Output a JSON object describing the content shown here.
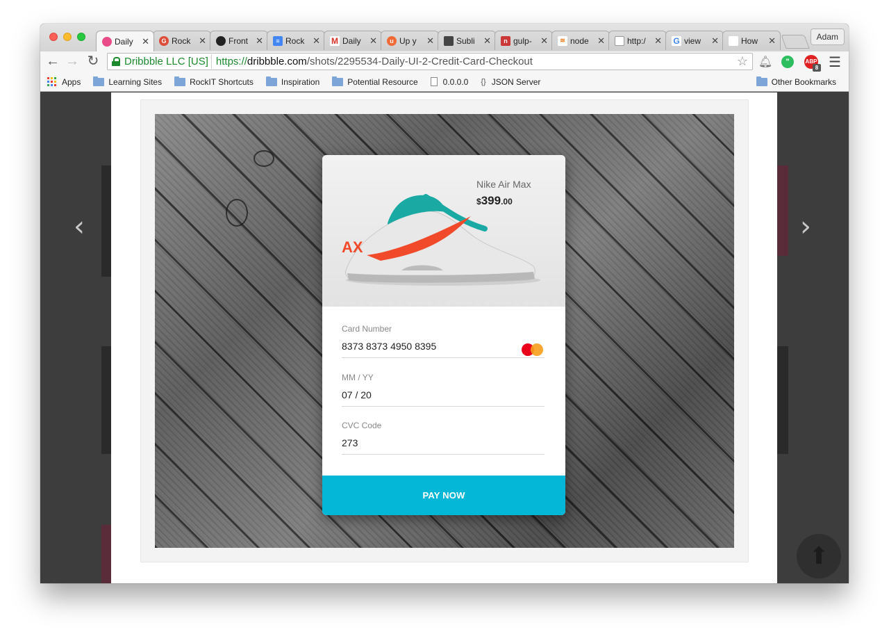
{
  "window": {
    "profile_label": "Adam"
  },
  "tabs": [
    {
      "title": "Daily",
      "icon": "dribbble-icon",
      "color": "#ea4c89"
    },
    {
      "title": "Rock",
      "icon": "google-plus-icon",
      "color": "#dd4b39"
    },
    {
      "title": "Front",
      "icon": "github-icon",
      "color": "#222222"
    },
    {
      "title": "Rock",
      "icon": "google-docs-icon",
      "color": "#4285f4"
    },
    {
      "title": "Daily",
      "icon": "gmail-icon",
      "color": "#d93025"
    },
    {
      "title": "Up y",
      "icon": "upwork-icon",
      "color": "#f06a35"
    },
    {
      "title": "Subli",
      "icon": "sublime-icon",
      "color": "#444444"
    },
    {
      "title": "gulp-",
      "icon": "npm-icon",
      "color": "#cb3837"
    },
    {
      "title": "node",
      "icon": "stackoverflow-icon",
      "color": "#f48024"
    },
    {
      "title": "http:/",
      "icon": "page-icon",
      "color": "#999999"
    },
    {
      "title": "view",
      "icon": "google-icon",
      "color": "#4285f4"
    },
    {
      "title": "How",
      "icon": "apple-icon",
      "color": "#555555"
    }
  ],
  "toolbar": {
    "secure_label": "Dribbble LLC [US]",
    "url_scheme": "https://",
    "url_host": "dribbble.com",
    "url_path": "/shots/2295534-Daily-UI-2-Credit-Card-Checkout",
    "abp_count": "8"
  },
  "bookmarks": {
    "items": [
      {
        "label": "Apps",
        "icon": "apps-icon"
      },
      {
        "label": "Learning Sites",
        "icon": "folder-icon"
      },
      {
        "label": "RockIT Shortcuts",
        "icon": "folder-icon"
      },
      {
        "label": "Inspiration",
        "icon": "folder-icon"
      },
      {
        "label": "Potential Resource",
        "icon": "folder-icon"
      },
      {
        "label": "0.0.0.0",
        "icon": "page-icon"
      },
      {
        "label": "JSON Server",
        "icon": "json-icon"
      }
    ],
    "other_label": "Other Bookmarks"
  },
  "checkout": {
    "product_name": "Nike Air Max",
    "price_currency": "$",
    "price_whole": "399",
    "price_cents": ".00",
    "card_number_label": "Card Number",
    "card_number_value": "8373 8373 4950 8395",
    "card_brand": "mastercard-icon",
    "expiry_label": "MM / YY",
    "expiry_value": "07 / 20",
    "cvc_label": "CVC Code",
    "cvc_value": "273",
    "pay_button": "PAY NOW",
    "accent_color": "#05b7d6"
  }
}
